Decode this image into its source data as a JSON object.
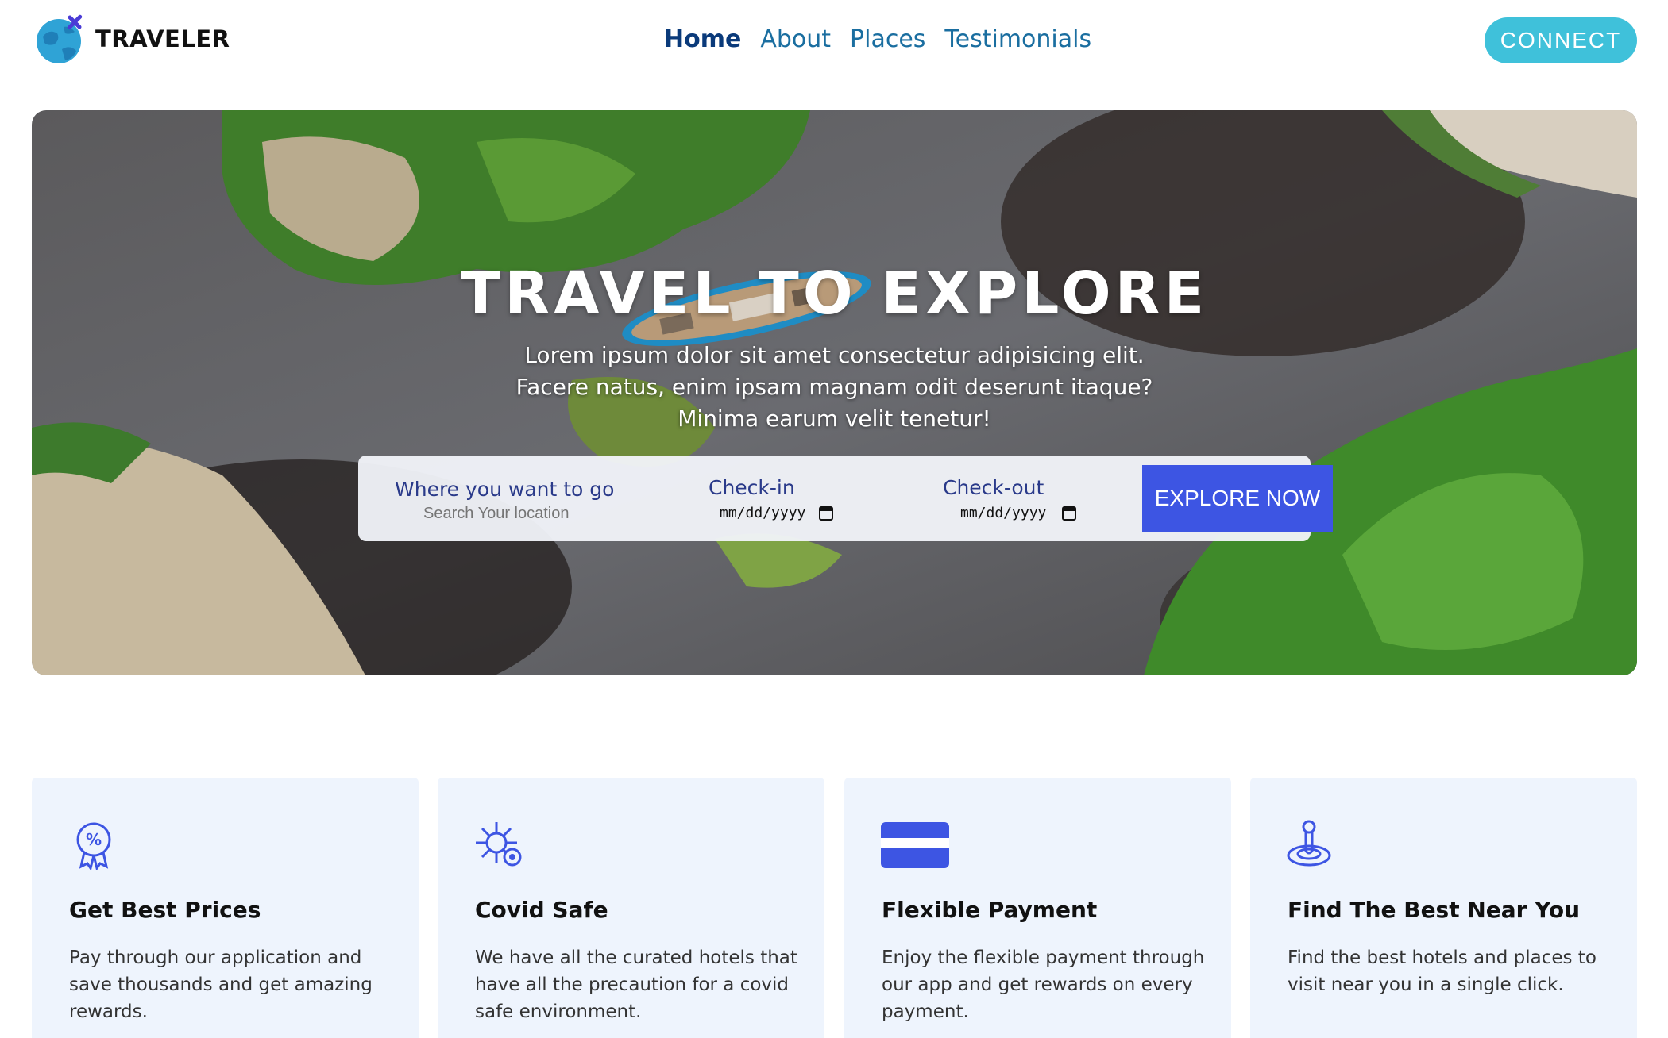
{
  "brand": {
    "name": "TRAVELER"
  },
  "nav": {
    "items": [
      {
        "label": "Home",
        "active": true
      },
      {
        "label": "About",
        "active": false
      },
      {
        "label": "Places",
        "active": false
      },
      {
        "label": "Testimonials",
        "active": false
      }
    ],
    "connect_label": "CONNECT"
  },
  "hero": {
    "title": "TRAVEL TO EXPLORE",
    "subtitle_lines": [
      "Lorem ipsum dolor sit amet consectetur adipisicing elit.",
      "Facere natus, enim ipsam magnam odit deserunt itaque?",
      "Minima earum velit tenetur!"
    ]
  },
  "search": {
    "destination_label": "Where you want to go",
    "destination_placeholder": "Search Your location",
    "checkin_label": "Check-in",
    "checkin_value": "mm/dd/yyyy",
    "checkout_label": "Check-out",
    "checkout_value": "mm/dd/yyyy",
    "explore_label": "EXPLORE NOW"
  },
  "features": [
    {
      "icon": "discount-badge-icon",
      "title": "Get Best Prices",
      "text": "Pay through our application and save thousands and get amazing rewards."
    },
    {
      "icon": "virus-shield-icon",
      "title": "Covid Safe",
      "text": "We have all the curated hotels that have all the precaution for a covid safe environment."
    },
    {
      "icon": "credit-card-icon",
      "title": "Flexible Payment",
      "text": "Enjoy the flexible payment through our app and get rewards on every payment."
    },
    {
      "icon": "location-pin-icon",
      "title": "Find The Best Near You",
      "text": "Find the best hotels and places to visit near you in a single click."
    }
  ],
  "colors": {
    "accent": "#3fc1da",
    "nav_active": "#0a3a7a",
    "nav_link": "#1a6ea0",
    "explore_button": "#3d55e3",
    "card_bg": "#eef4fd",
    "icon": "#3d55e3"
  }
}
